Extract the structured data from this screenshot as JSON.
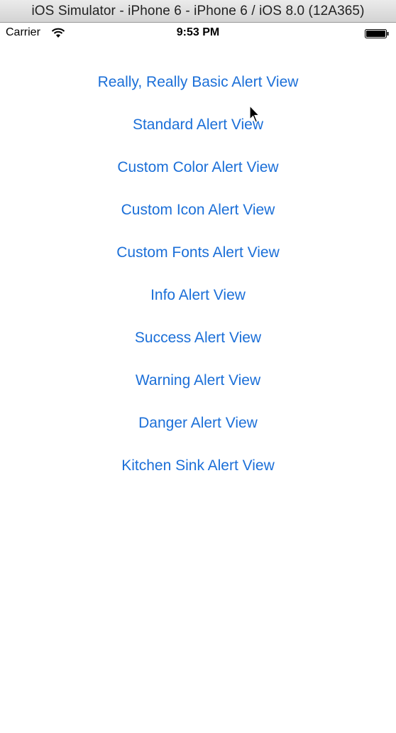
{
  "window": {
    "title": "iOS Simulator - iPhone 6 - iPhone 6 / iOS 8.0 (12A365)"
  },
  "status_bar": {
    "carrier": "Carrier",
    "time": "9:53 PM",
    "wifi_icon": "wifi-icon",
    "battery_icon": "battery-icon"
  },
  "alert_buttons": [
    {
      "label": "Really, Really Basic Alert View"
    },
    {
      "label": "Standard Alert View"
    },
    {
      "label": "Custom Color Alert View"
    },
    {
      "label": "Custom Icon Alert View"
    },
    {
      "label": "Custom Fonts Alert View"
    },
    {
      "label": "Info Alert View"
    },
    {
      "label": "Success Alert View"
    },
    {
      "label": "Warning Alert View"
    },
    {
      "label": "Danger Alert View"
    },
    {
      "label": "Kitchen Sink Alert View"
    }
  ],
  "colors": {
    "link": "#1b6fd8",
    "background": "#ffffff"
  }
}
